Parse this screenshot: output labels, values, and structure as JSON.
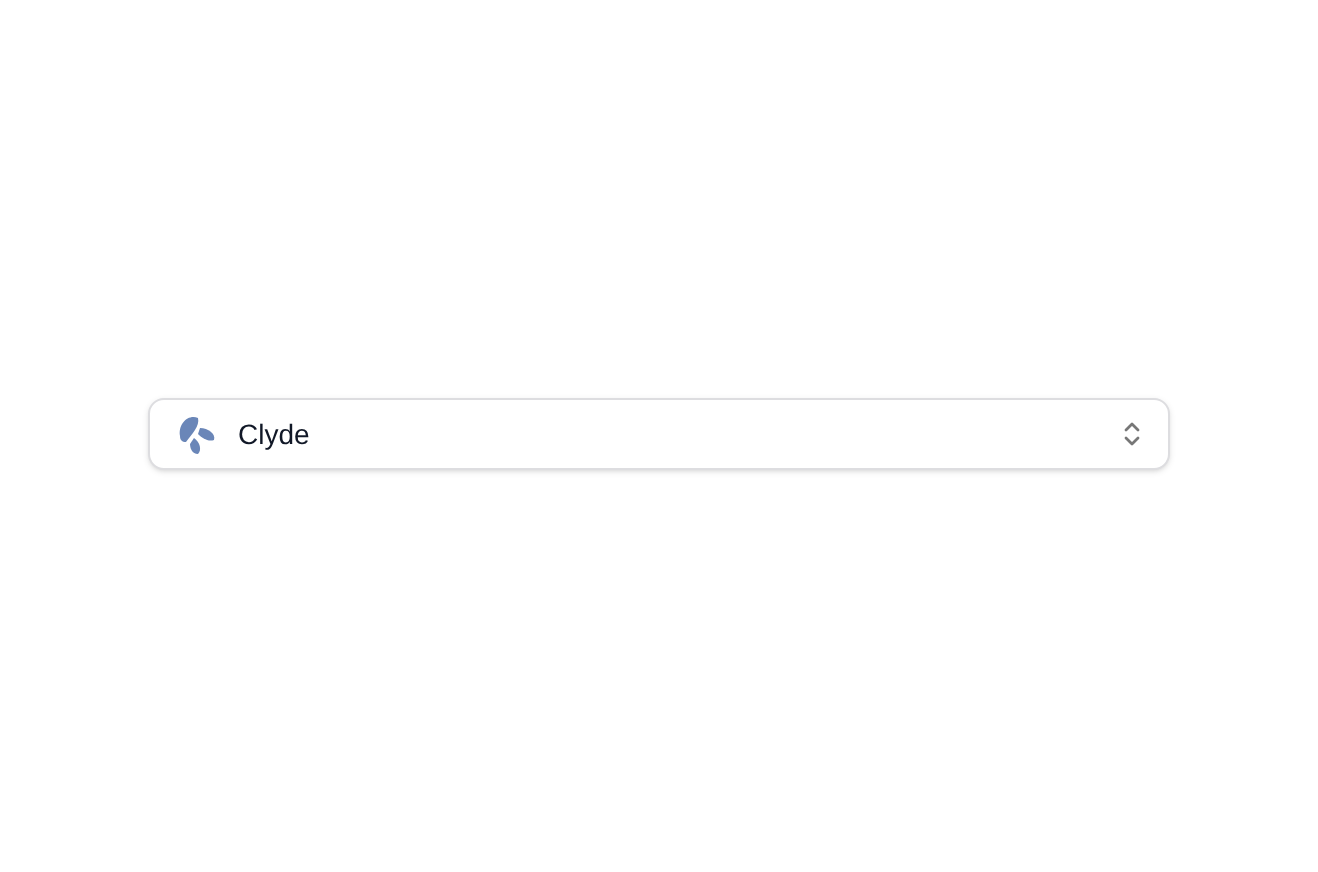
{
  "select": {
    "value": "Clyde"
  }
}
